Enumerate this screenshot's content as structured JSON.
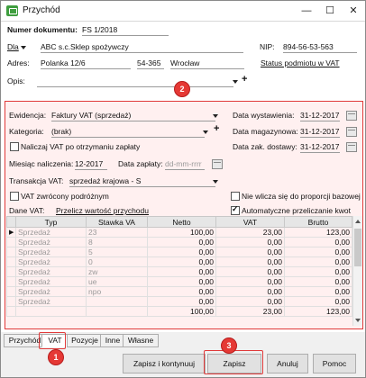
{
  "window": {
    "title": "Przychód",
    "minimize": "—",
    "maximize": "☐",
    "close": "✕"
  },
  "header": {
    "doc_number_label": "Numer dokumentu:",
    "doc_number": "FS 1/2018",
    "dla_label": "Dla",
    "client_name": "ABC s.c.Sklep spożywczy",
    "nip_label": "NIP:",
    "nip": "894-56-53-563",
    "adres_label": "Adres:",
    "street": "Polanka 12/6",
    "postal": "54-365",
    "city": "Wrocław",
    "vat_status_link": "Status podmiotu w VAT",
    "opis_label": "Opis:",
    "opis_value": ""
  },
  "vat_panel": {
    "ewidencja_label": "Ewidencja:",
    "ewidencja_value": "Faktury VAT (sprzedaż)",
    "kategoria_label": "Kategoria:",
    "kategoria_value": "(brak)",
    "naliczaj_label": "Naliczaj VAT po otrzymaniu zapłaty",
    "miesiac_label": "Miesiąc naliczenia:",
    "miesiac_value": "12-2017",
    "data_zaplaty_label": "Data zapłaty:",
    "data_zaplaty_placeholder": "dd-mm-rrrr",
    "transakcja_label": "Transakcja VAT:",
    "transakcja_value": "sprzedaż krajowa - S",
    "zwrocony_label": "VAT zwrócony podróżnym",
    "nie_wlicza_label": "Nie wlicza się do proporcji bazowej",
    "dane_vat_label": "Dane VAT:",
    "przelicz_link": "Przelicz wartość przychodu",
    "auto_przelicz_label": "Automatyczne przeliczanie kwot",
    "data_wystawienia_label": "Data wystawienia:",
    "data_wystawienia": "31-12-2017",
    "data_magazynowa_label": "Data magazynowa:",
    "data_magazynowa": "31-12-2017",
    "data_zak_label": "Data zak. dostawy:",
    "data_zak": "31-12-2017"
  },
  "table": {
    "columns": [
      "Typ",
      "Stawka VA",
      "Netto",
      "VAT",
      "Brutto"
    ],
    "rows": [
      {
        "typ": "Sprzedaż",
        "stawka": "23",
        "netto": "100,00",
        "vat": "23,00",
        "brutto": "123,00"
      },
      {
        "typ": "Sprzedaż",
        "stawka": "8",
        "netto": "0,00",
        "vat": "0,00",
        "brutto": "0,00"
      },
      {
        "typ": "Sprzedaż",
        "stawka": "5",
        "netto": "0,00",
        "vat": "0,00",
        "brutto": "0,00"
      },
      {
        "typ": "Sprzedaż",
        "stawka": "0",
        "netto": "0,00",
        "vat": "0,00",
        "brutto": "0,00"
      },
      {
        "typ": "Sprzedaż",
        "stawka": "zw",
        "netto": "0,00",
        "vat": "0,00",
        "brutto": "0,00"
      },
      {
        "typ": "Sprzedaż",
        "stawka": "ue",
        "netto": "0,00",
        "vat": "0,00",
        "brutto": "0,00"
      },
      {
        "typ": "Sprzedaż",
        "stawka": "npo",
        "netto": "0,00",
        "vat": "0,00",
        "brutto": "0,00"
      },
      {
        "typ": "Sprzedaż",
        "stawka": "",
        "netto": "0,00",
        "vat": "0,00",
        "brutto": "0,00"
      }
    ],
    "totals": {
      "netto": "100,00",
      "vat": "23,00",
      "brutto": "123,00"
    }
  },
  "tabs": [
    "Przychód",
    "VAT",
    "Pozycje",
    "Inne",
    "Własne"
  ],
  "buttons": {
    "zapisz_kontynuuj": "Zapisz i kontynuuj",
    "zapisz": "Zapisz",
    "anuluj": "Anuluj",
    "pomoc": "Pomoc"
  },
  "badges": [
    "1",
    "2",
    "3"
  ],
  "colors": {
    "highlight": "#e03a3a",
    "badge": "#e53935",
    "app_icon": "#3f9e3f"
  }
}
